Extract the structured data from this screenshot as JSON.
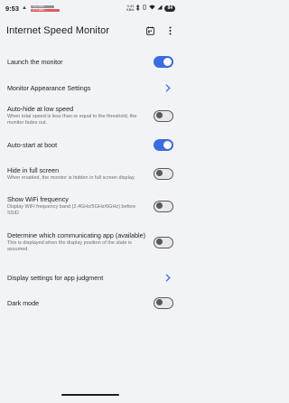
{
  "status": {
    "time": "9:53",
    "alert_glyph": "▲",
    "upload_speed": "79.2 KB/s",
    "download_speed": "27.5 MB/s",
    "net_rate_top": "0.41",
    "net_rate_bottom": "KB/s",
    "battery": "84"
  },
  "header": {
    "title": "Internet Speed Monitor",
    "icons": [
      "calendar-icon",
      "more-vert-icon"
    ]
  },
  "settings": [
    {
      "title": "Launch the monitor",
      "subtitle": "",
      "control": "toggle",
      "on": true
    },
    {
      "title": "Monitor Appearance Settings",
      "subtitle": "",
      "control": "chevron"
    },
    {
      "title": "Auto-hide at low speed",
      "subtitle": "When total speed is less than or equal to the threshold, the monitor fades out.",
      "control": "toggle",
      "on": false
    },
    {
      "title": "Auto-start at boot",
      "subtitle": "",
      "control": "toggle",
      "on": true
    },
    {
      "title": "Hide in full screen",
      "subtitle": "When enabled, the monitor is hidden in full screen display.",
      "control": "toggle",
      "on": false
    },
    {
      "title": "Show WiFi frequency",
      "subtitle": "Display WiFi frequency band (2.4GHz/5GHz/6GHz) before SSID",
      "control": "toggle",
      "on": false
    },
    {
      "title": "Determine which communicating app (available)",
      "subtitle": "This is displayed when the display position of the state is assumed.",
      "control": "toggle",
      "on": false
    },
    {
      "title": "Display settings for app judgment",
      "subtitle": "",
      "control": "chevron"
    },
    {
      "title": "Dark mode",
      "subtitle": "",
      "control": "toggle",
      "on": false
    }
  ],
  "colors": {
    "accent": "#3a6cdf",
    "background": "#f2f3f7",
    "download_bar": "#e05a5a",
    "upload_bar": "#8e8e95"
  }
}
